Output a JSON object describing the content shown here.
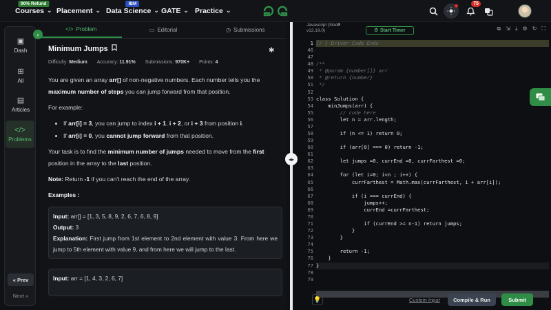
{
  "nav": {
    "items": [
      {
        "label": "Courses",
        "badge": "90% Refund"
      },
      {
        "label": "Placement",
        "badge": ""
      },
      {
        "label": "Data Science",
        "badge": "IBM"
      },
      {
        "label": "GATE",
        "badge": ""
      },
      {
        "label": "Practice",
        "badge": ""
      }
    ],
    "logo": "GG",
    "notif_count": "75"
  },
  "rail": {
    "items": [
      {
        "label": "Dash",
        "icon": "dashboard-icon"
      },
      {
        "label": "All",
        "icon": "grid-icon"
      },
      {
        "label": "Articles",
        "icon": "article-icon"
      },
      {
        "label": "Problems",
        "icon": "code-icon"
      }
    ],
    "prev_label": "« Prev",
    "next_label": "Next »"
  },
  "tabs": [
    {
      "label": "Problem"
    },
    {
      "label": "Editorial"
    },
    {
      "label": "Submissions"
    }
  ],
  "problem": {
    "title": "Minimum Jumps",
    "difficulty_label": "Difficulty:",
    "difficulty": "Medium",
    "accuracy_label": "Accuracy:",
    "accuracy": "11.91%",
    "submissions_label": "Submissions:",
    "submissions": "970K+",
    "points_label": "Points:",
    "points": "4",
    "p1a": "You are given an array ",
    "p1b": "arr[]",
    "p1c": " of non-negative numbers. Each number tells you the ",
    "p1d": "maximum number of steps",
    "p1e": " you can jump forward from that position.",
    "p2": "For example:",
    "li1a": "If ",
    "li1b": "arr[i] = 3",
    "li1c": ", you can jump to index ",
    "li1d": "i + 1",
    "li1e": ", ",
    "li1f": "i + 2",
    "li1g": ", or ",
    "li1h": "i + 3",
    "li1i": " from position ",
    "li1j": "i",
    "li1k": ".",
    "li2a": "If ",
    "li2b": "arr[i] = 0",
    "li2c": ", you ",
    "li2d": "cannot jump forward",
    "li2e": " from that position.",
    "p3a": "Your task is to find the ",
    "p3b": "minimum number of jumps",
    "p3c": " needed to move from the ",
    "p3d": "first",
    "p3e": " position in the array to the ",
    "p3f": "last",
    "p3g": " position.",
    "note_label": "Note:",
    "note_a": "  Return ",
    "note_b": "-1",
    "note_c": " if you can't reach the end of the array.",
    "examples_label": "Examples :",
    "ex1_input_label": "Input:",
    "ex1_input": " arr[] = [1, 3, 5, 8, 9, 2, 6, 7, 6, 8, 9]",
    "ex1_output_label": "Output:",
    "ex1_output": " 3",
    "ex1_expl_label": "Explanation:",
    "ex1_expl": " First jump from 1st element to 2nd element with value 3. From here we jump to 5th element with value 9, and from here we will jump to the last.",
    "ex2_input_label": "Input:",
    "ex2_input": " arr = [1, 4, 3, 2, 6, 7]"
  },
  "editor": {
    "lang": "Javascript (Node v12.19.0)",
    "timer_label": "Start Timer",
    "line_numbers": [
      "1",
      "46",
      "47",
      "48",
      "49",
      "50",
      "51",
      "52",
      "53",
      "54",
      "55",
      "56",
      "57",
      "58",
      "59",
      "60",
      "61",
      "62",
      "63",
      "64",
      "65",
      "66",
      "67",
      "68",
      "69",
      "70",
      "71",
      "72",
      "73",
      "74",
      "75",
      "76",
      "77",
      "78",
      "79"
    ],
    "custom_input": "Custom Input",
    "compile_label": "Compile & Run",
    "submit_label": "Submit"
  },
  "code_lines": [
    "// } Driver Code Ends",
    "",
    "",
    "/**",
    " * @param {number[]} arr",
    " * @return {number}",
    " */",
    "",
    "class Solution {",
    "    minJumps(arr) {",
    "        // code here",
    "        let n = arr.length;",
    "",
    "        if (n <= 1) return 0;",
    "",
    "        if (arr[0] === 0) return -1;",
    "",
    "        let jumps =0, currEnd =0, currFarthest =0;",
    "",
    "        for (let i=0; i<n ; i++) {",
    "            currFarthest = Math.max(currFarthest, i + arr[i]);",
    "",
    "            if (i === currEnd) {",
    "                jumps++;",
    "                currEnd =currFarthest;",
    "",
    "                if (currEnd >= n-1) return jumps;",
    "            }",
    "        }",
    "",
    "        return -1;",
    "    }",
    "}",
    "",
    ""
  ]
}
